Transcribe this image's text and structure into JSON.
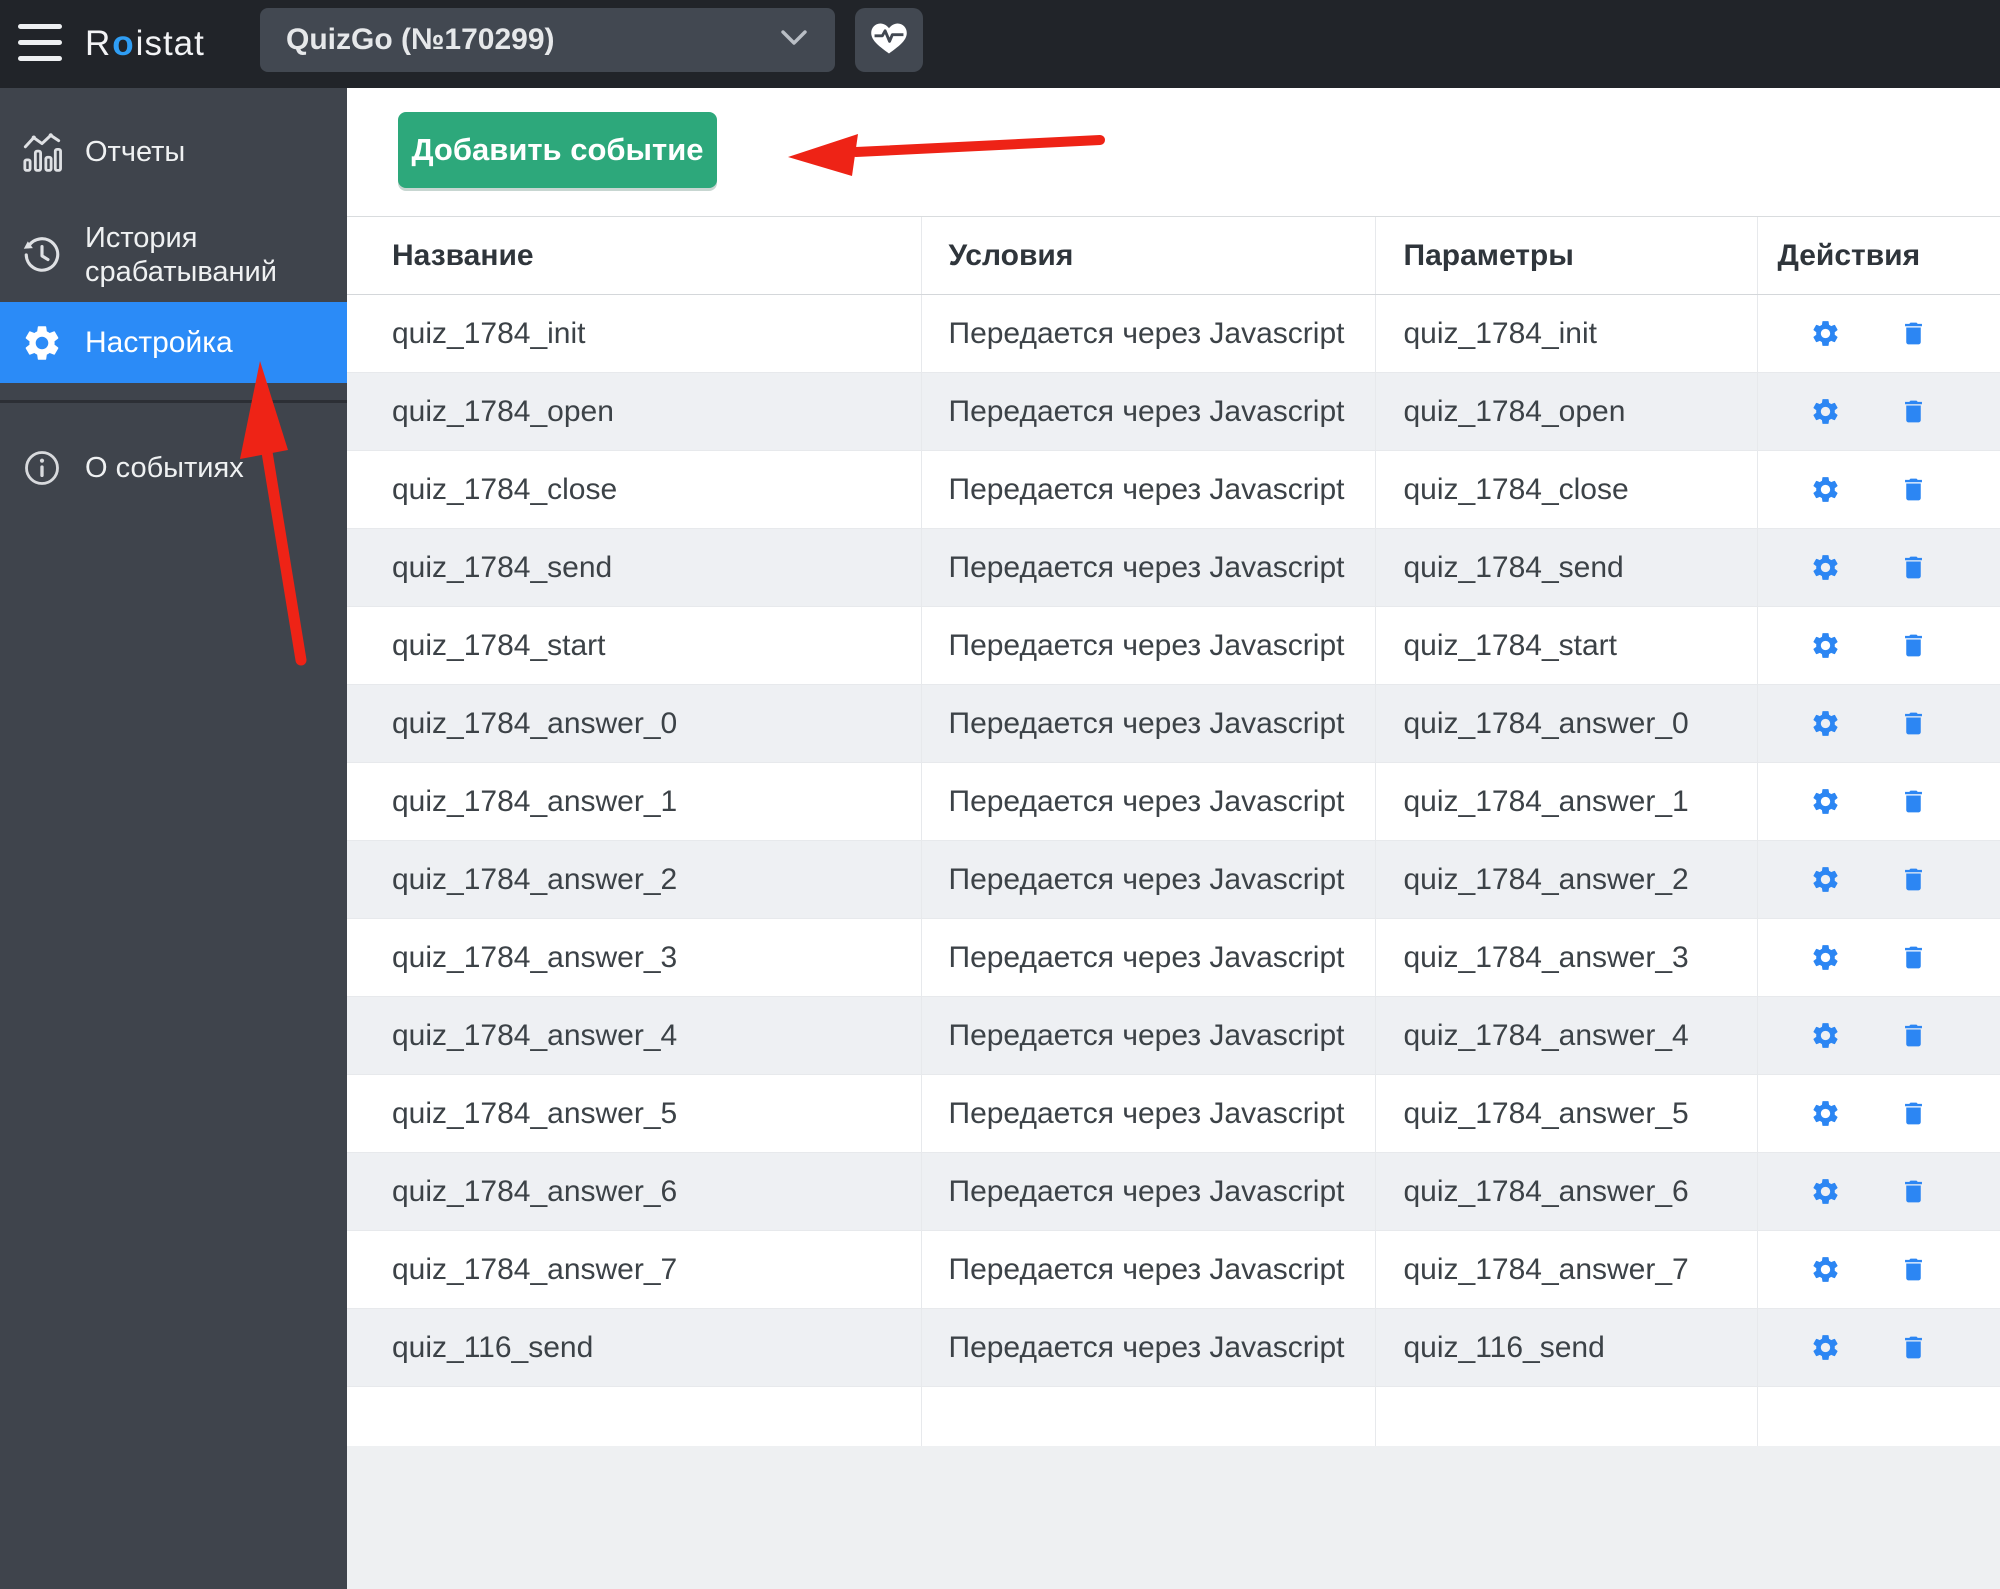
{
  "topbar": {
    "logo": {
      "r": "R",
      "o": "o",
      "rest": "istat"
    },
    "project_selector": {
      "value": "QuizGo (№170299)"
    },
    "icons": {
      "menu": "hamburger-menu",
      "chevron": "chevron-down",
      "health": "heart-pulse"
    }
  },
  "sidebar": {
    "items": [
      {
        "label": "Отчеты",
        "icon": "bar-chart",
        "active": false
      },
      {
        "label": "История срабатываний",
        "icon": "history-clock",
        "active": false
      },
      {
        "label": "Настройка",
        "icon": "gear",
        "active": true
      },
      {
        "label": "О событиях",
        "icon": "info-circle",
        "active": false
      }
    ]
  },
  "main": {
    "add_event_button": "Добавить событие",
    "table": {
      "columns": [
        "Название",
        "Условия",
        "Параметры",
        "Действия"
      ],
      "row_action_icons": [
        "gear",
        "trash"
      ],
      "rows": [
        {
          "name": "quiz_1784_init",
          "condition": "Передается через Javascript",
          "params": "quiz_1784_init"
        },
        {
          "name": "quiz_1784_open",
          "condition": "Передается через Javascript",
          "params": "quiz_1784_open"
        },
        {
          "name": "quiz_1784_close",
          "condition": "Передается через Javascript",
          "params": "quiz_1784_close"
        },
        {
          "name": "quiz_1784_send",
          "condition": "Передается через Javascript",
          "params": "quiz_1784_send"
        },
        {
          "name": "quiz_1784_start",
          "condition": "Передается через Javascript",
          "params": "quiz_1784_start"
        },
        {
          "name": "quiz_1784_answer_0",
          "condition": "Передается через Javascript",
          "params": "quiz_1784_answer_0"
        },
        {
          "name": "quiz_1784_answer_1",
          "condition": "Передается через Javascript",
          "params": "quiz_1784_answer_1"
        },
        {
          "name": "quiz_1784_answer_2",
          "condition": "Передается через Javascript",
          "params": "quiz_1784_answer_2"
        },
        {
          "name": "quiz_1784_answer_3",
          "condition": "Передается через Javascript",
          "params": "quiz_1784_answer_3"
        },
        {
          "name": "quiz_1784_answer_4",
          "condition": "Передается через Javascript",
          "params": "quiz_1784_answer_4"
        },
        {
          "name": "quiz_1784_answer_5",
          "condition": "Передается через Javascript",
          "params": "quiz_1784_answer_5"
        },
        {
          "name": "quiz_1784_answer_6",
          "condition": "Передается через Javascript",
          "params": "quiz_1784_answer_6"
        },
        {
          "name": "quiz_1784_answer_7",
          "condition": "Передается через Javascript",
          "params": "quiz_1784_answer_7"
        },
        {
          "name": "quiz_116_send",
          "condition": "Передается через Javascript",
          "params": "quiz_116_send"
        }
      ]
    }
  },
  "annotations": {
    "arrows": [
      "arrow-to-add-event-button",
      "arrow-to-settings-item"
    ],
    "arrow_color": "#ee2316"
  },
  "colors": {
    "topbar_bg": "#212429",
    "sidebar_bg": "#3f444c",
    "active_item_blue": "#2b8bf7",
    "button_green": "#2da87b",
    "action_icon_blue": "#2c86f3",
    "stripe_gray": "#eef0f3",
    "annotation_red": "#ee2316",
    "logo_accent_blue": "#2f9ef5"
  }
}
